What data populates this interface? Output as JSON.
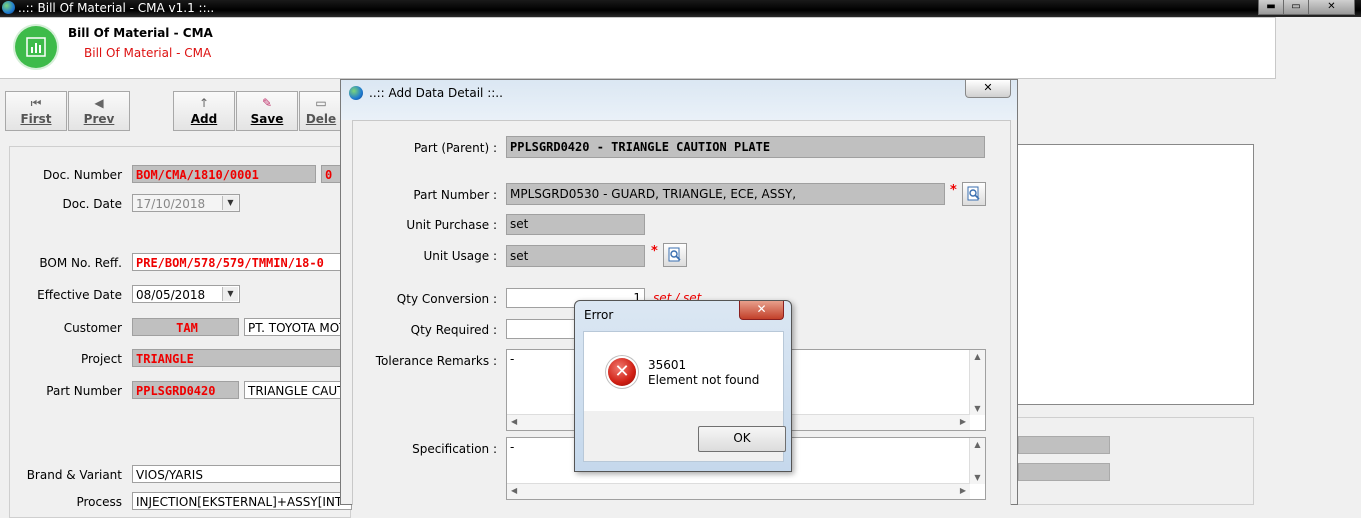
{
  "window": {
    "title": "..:: Bill Of Material - CMA v1.1 ::..",
    "min": "▬",
    "max": "▭",
    "close": "✕"
  },
  "header": {
    "app_name": "Bill Of Material - CMA",
    "app_subtitle": "Bill Of Material - CMA"
  },
  "toolbar": {
    "first": "First",
    "prev": "Prev",
    "add": "Add",
    "save": "Save",
    "delete": "Dele"
  },
  "form": {
    "doc_number_label": "Doc. Number",
    "doc_number": "BOM/CMA/1810/0001",
    "doc_number_extra": "0",
    "doc_date_label": "Doc. Date",
    "doc_date": "17/10/2018",
    "bom_reff_label": "BOM No. Reff.",
    "bom_reff": "PRE/BOM/578/579/TMMIN/18-0",
    "effective_date_label": "Effective Date",
    "effective_date": "08/05/2018",
    "customer_label": "Customer",
    "customer_code": "TAM",
    "customer_name": "PT. TOYOTA MOT",
    "project_label": "Project",
    "project": "TRIANGLE",
    "part_number_label": "Part Number",
    "part_number": "PPLSGRD0420",
    "part_name": "TRIANGLE CAUTI",
    "brand_label": "Brand & Variant",
    "brand": "VIOS/YARIS",
    "process_label": "Process",
    "process": "INJECTION[EKSTERNAL]+ASSY[INT"
  },
  "dialog": {
    "title": "..:: Add Data Detail ::..",
    "close": "✕",
    "part_parent_label": "Part (Parent) :",
    "part_parent": "PPLSGRD0420 - TRIANGLE CAUTION PLATE",
    "part_number_label": "Part Number :",
    "part_number": "MPLSGRD0530 - GUARD, TRIANGLE, ECE,  ASSY,",
    "unit_purchase_label": "Unit Purchase :",
    "unit_purchase": "set",
    "unit_usage_label": "Unit Usage :",
    "unit_usage": "set",
    "qty_conversion_label": "Qty Conversion :",
    "qty_conversion": "1",
    "qty_conversion_unit": "set / set",
    "qty_required_label": "Qty Required :",
    "qty_required": "",
    "tolerance_label": "Tolerance Remarks :",
    "tolerance": "-",
    "specification_label": "Specification :",
    "specification": "-",
    "required_mark": "*"
  },
  "error": {
    "title": "Error",
    "close": "✕",
    "code": "35601",
    "message": "Element not found",
    "ok": "OK"
  },
  "colors": {
    "accent_red": "#e00000",
    "logo_green": "#3ebb4a"
  },
  "icons": {
    "app": "globe-icon",
    "logo": "bar-chart-icon",
    "error": "error-icon",
    "lookup": "search-document-icon"
  }
}
